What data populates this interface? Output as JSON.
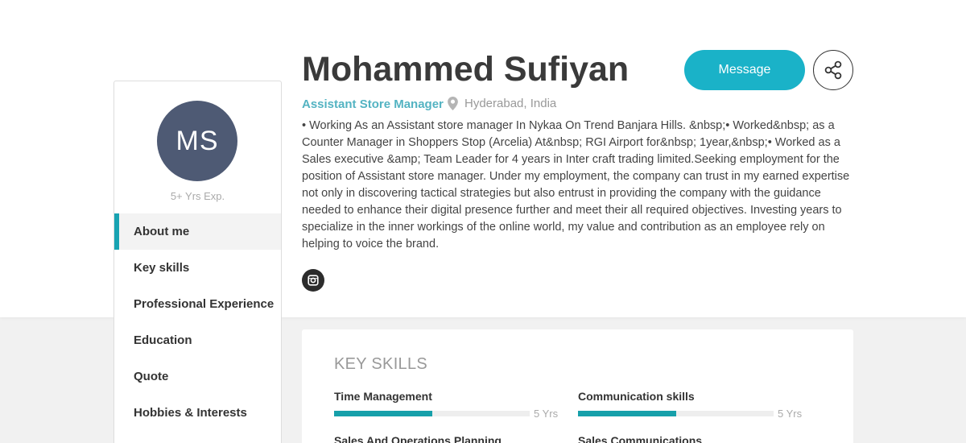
{
  "profile": {
    "initials": "MS",
    "experience": "5+ Yrs Exp.",
    "name": "Mohammed Sufiyan",
    "role": "Assistant Store Manager",
    "location": "Hyderabad, India",
    "bio": "• Working As an Assistant store manager In Nykaa On Trend Banjara Hills. &nbsp;• Worked&nbsp; as a Counter Manager in Shoppers Stop (Arcelia) At&nbsp; RGI Airport for&nbsp; 1year,&nbsp;• Worked as a Sales executive &amp; Team Leader for 4 years in Inter craft trading limited.Seeking employment for the position of Assistant store manager. Under my employment, the company can trust in my earned expertise not only in discovering tactical strategies but also entrust in providing the company with the guidance needed to enhance their digital presence further and meet their all required objectives. Investing years to specialize in the inner workings of the online world, my value and contribution as an employee rely on helping to voice the brand."
  },
  "actions": {
    "message_label": "Message"
  },
  "nav": {
    "items": [
      {
        "label": "About me"
      },
      {
        "label": "Key skills"
      },
      {
        "label": "Professional Experience"
      },
      {
        "label": "Education"
      },
      {
        "label": "Quote"
      },
      {
        "label": "Hobbies & Interests"
      }
    ]
  },
  "skills": {
    "title": "KEY SKILLS",
    "items": [
      {
        "name": "Time Management",
        "years": "5 Yrs",
        "level": 0.5
      },
      {
        "name": "Communication skills",
        "years": "5 Yrs",
        "level": 0.5
      },
      {
        "name": "Sales And Operations Planning",
        "years": "",
        "level": 0
      },
      {
        "name": "Sales Communications",
        "years": "",
        "level": 0
      }
    ]
  },
  "colors": {
    "accent": "#1ab2c8",
    "avatar_bg": "#4e5a74",
    "skill_bar": "#17a0aa"
  },
  "icons": [
    "location-pin-icon",
    "instagram-icon",
    "share-icon"
  ]
}
